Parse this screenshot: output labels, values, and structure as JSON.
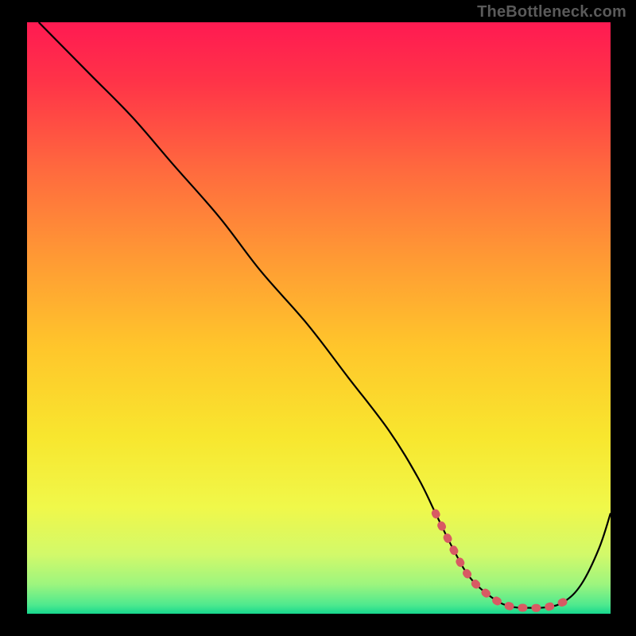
{
  "watermark": "TheBottleneck.com",
  "colors": {
    "background": "#000000",
    "curve_stroke": "#000000",
    "highlight_stroke": "#d85a63",
    "frame": "#000000"
  },
  "chart_data": {
    "type": "line",
    "title": "",
    "xlabel": "",
    "ylabel": "",
    "xlim": [
      0,
      100
    ],
    "ylim": [
      0,
      100
    ],
    "grid": false,
    "legend": false,
    "gradient_stops": [
      {
        "offset": 0.0,
        "color": "#ff1a52"
      },
      {
        "offset": 0.1,
        "color": "#ff3348"
      },
      {
        "offset": 0.25,
        "color": "#ff6a3e"
      },
      {
        "offset": 0.4,
        "color": "#ff9a34"
      },
      {
        "offset": 0.55,
        "color": "#ffc62b"
      },
      {
        "offset": 0.7,
        "color": "#f8e62e"
      },
      {
        "offset": 0.82,
        "color": "#f0f84a"
      },
      {
        "offset": 0.9,
        "color": "#d2f96a"
      },
      {
        "offset": 0.95,
        "color": "#9df57e"
      },
      {
        "offset": 0.985,
        "color": "#4fe98e"
      },
      {
        "offset": 1.0,
        "color": "#17d88e"
      }
    ],
    "series": [
      {
        "name": "bottleneck-curve",
        "x": [
          2,
          6,
          11,
          18,
          25,
          33,
          40,
          48,
          55,
          62,
          67,
          70,
          73,
          76,
          80,
          83,
          86,
          89,
          92,
          95,
          98,
          100
        ],
        "y": [
          100,
          96,
          91,
          84,
          76,
          67,
          58,
          49,
          40,
          31,
          23,
          17,
          11,
          6,
          2.5,
          1.2,
          1.0,
          1.1,
          2.0,
          5,
          11,
          17
        ]
      }
    ],
    "highlight_segment": {
      "series": "bottleneck-curve",
      "x": [
        70,
        73,
        76,
        80,
        83,
        86,
        89,
        92
      ],
      "y": [
        17,
        11,
        6,
        2.5,
        1.2,
        1.0,
        1.1,
        2.0
      ],
      "style": "thick-dotted"
    }
  }
}
